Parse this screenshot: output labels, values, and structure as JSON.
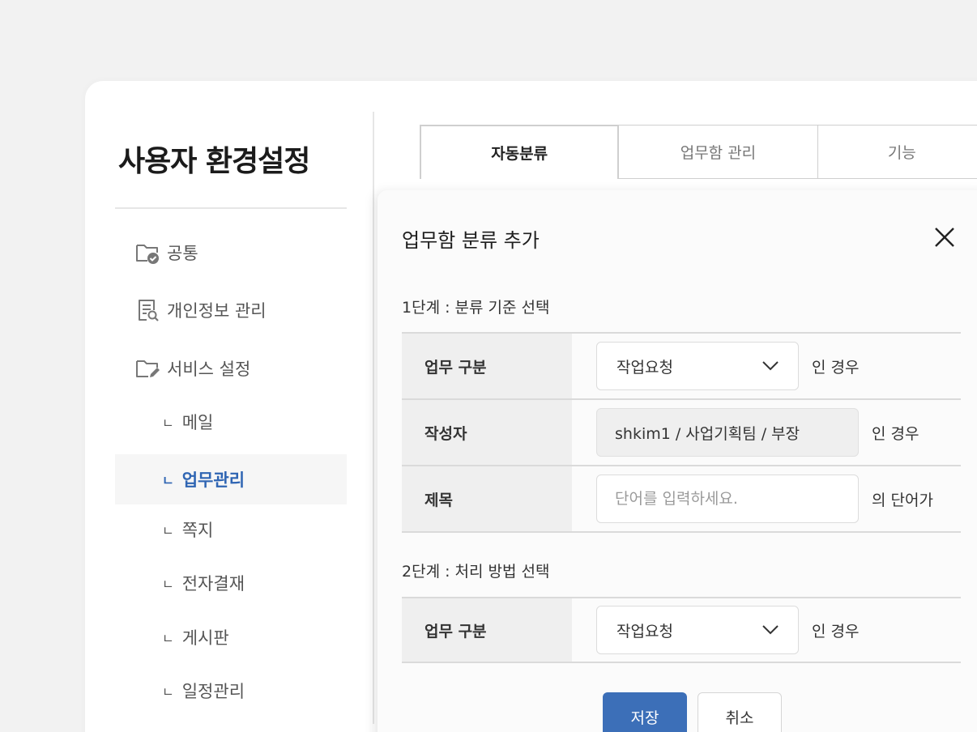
{
  "page": {
    "title": "사용자 환경설정"
  },
  "sidebar": {
    "items": [
      {
        "label": "공통",
        "icon": "folder-check-icon"
      },
      {
        "label": "개인정보 관리",
        "icon": "document-search-icon"
      },
      {
        "label": "서비스 설정",
        "icon": "folder-edit-icon"
      }
    ],
    "bullet": "ㄴ",
    "sub_items": [
      {
        "label": "메일"
      },
      {
        "label": "업무관리",
        "active": true
      },
      {
        "label": "쪽지"
      },
      {
        "label": "전자결재"
      },
      {
        "label": "게시판"
      },
      {
        "label": "일정관리"
      }
    ]
  },
  "tabs": [
    {
      "label": "자동분류",
      "active": true
    },
    {
      "label": "업무함 관리"
    },
    {
      "label": "기능"
    }
  ],
  "dialog": {
    "title": "업무함 분류 추가",
    "step1": {
      "label": "1단계 : 분류 기준 선택",
      "rows": [
        {
          "label": "업무 구분",
          "value": "작업요청",
          "suffix": "인 경우"
        },
        {
          "label": "작성자",
          "value": "shkim1 / 사업기획팀 / 부장",
          "suffix": "인 경우"
        },
        {
          "label": "제목",
          "placeholder": "단어를 입력하세요.",
          "suffix": "의 단어가"
        }
      ]
    },
    "step2": {
      "label": "2단계 : 처리 방법 선택",
      "rows": [
        {
          "label": "업무 구분",
          "value": "작업요청",
          "suffix": "인 경우"
        }
      ]
    },
    "buttons": {
      "save": "저장",
      "cancel": "취소"
    }
  },
  "colors": {
    "accent": "#3c6fb8",
    "active_text": "#2f65b3"
  }
}
